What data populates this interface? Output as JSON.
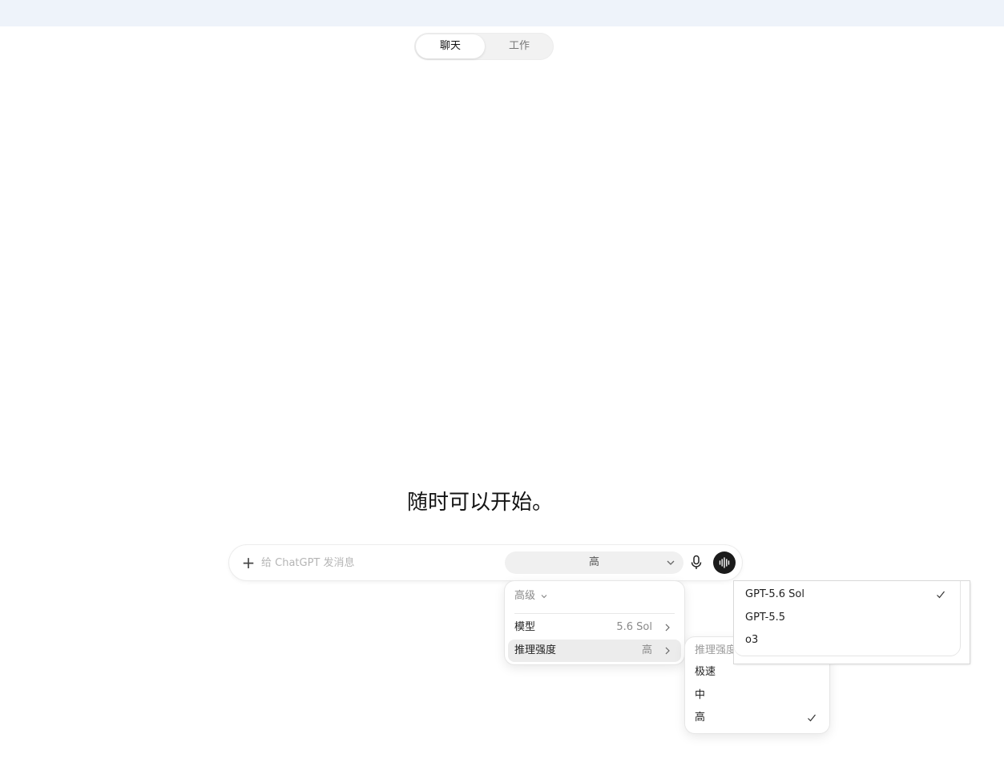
{
  "mode_switch": {
    "tabs": [
      {
        "label": "聊天",
        "active": true
      },
      {
        "label": "工作",
        "active": false
      }
    ]
  },
  "main": {
    "heading": "随时可以开始。"
  },
  "composer": {
    "placeholder": "给 ChatGPT 发消息",
    "value": "",
    "effort_selected": "高",
    "icons": {
      "add": "plus-icon",
      "mic": "microphone-icon",
      "voice": "voice-waveform-icon",
      "dropdown": "chevron-down-icon"
    }
  },
  "advanced_menu": {
    "header": "高级",
    "items": [
      {
        "label": "模型",
        "value": "5.6 Sol"
      },
      {
        "label": "推理强度",
        "value": "高"
      }
    ]
  },
  "effort_menu": {
    "header": "推理强度",
    "options": [
      {
        "label": "极速",
        "selected": false
      },
      {
        "label": "中",
        "selected": false
      },
      {
        "label": "高",
        "selected": true
      }
    ]
  },
  "model_menu": {
    "options": [
      {
        "label": "GPT-5.6 Sol",
        "selected": true
      },
      {
        "label": "GPT-5.5",
        "selected": false
      },
      {
        "label": "o3",
        "selected": false
      }
    ]
  },
  "colors": {
    "topbar": "#eef3fa",
    "voice_button": "#1b1b1b",
    "hover_row": "#ececec"
  }
}
